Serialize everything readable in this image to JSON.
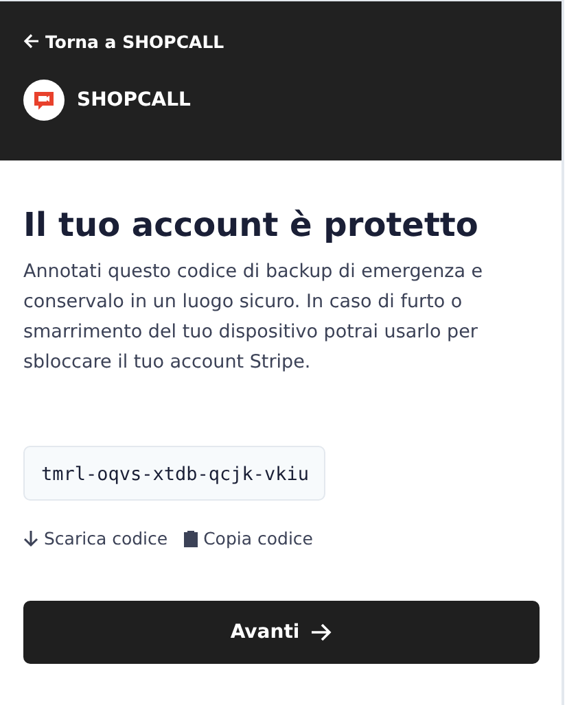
{
  "header": {
    "back_link": "Torna a SHOPCALL",
    "brand": "SHOPCALL"
  },
  "title": "Il tuo account è protetto",
  "description": "Annotati questo codice di backup di emergenza e conservalo in un luogo sicuro. In caso di furto o smarrimento del tuo dispositivo potrai usarlo per sbloccare il tuo account Stripe.",
  "backup_code": "tmrl-oqvs-xtdb-qcjk-vkiu",
  "actions": [
    {
      "kind": "download",
      "label": "Scarica codice"
    },
    {
      "kind": "copy",
      "label": "Copia codice"
    }
  ],
  "next_button": "Avanti"
}
